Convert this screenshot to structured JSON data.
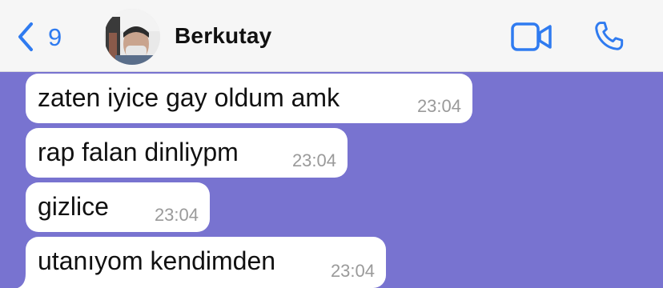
{
  "header": {
    "back_count": "9",
    "contact_name": "Berkutay",
    "icons": {
      "back": "chevron-left-icon",
      "video": "video-camera-icon",
      "call": "phone-icon"
    },
    "accent_color": "#2f7bf0"
  },
  "chat": {
    "background_color": "#7873d0",
    "messages": [
      {
        "text": "zaten iyice gay oldum amk",
        "time": "23:04"
      },
      {
        "text": "rap falan dinliypm",
        "time": "23:04"
      },
      {
        "text": "gizlice",
        "time": "23:04"
      },
      {
        "text": "utanıyom kendimden",
        "time": "23:04"
      }
    ]
  }
}
